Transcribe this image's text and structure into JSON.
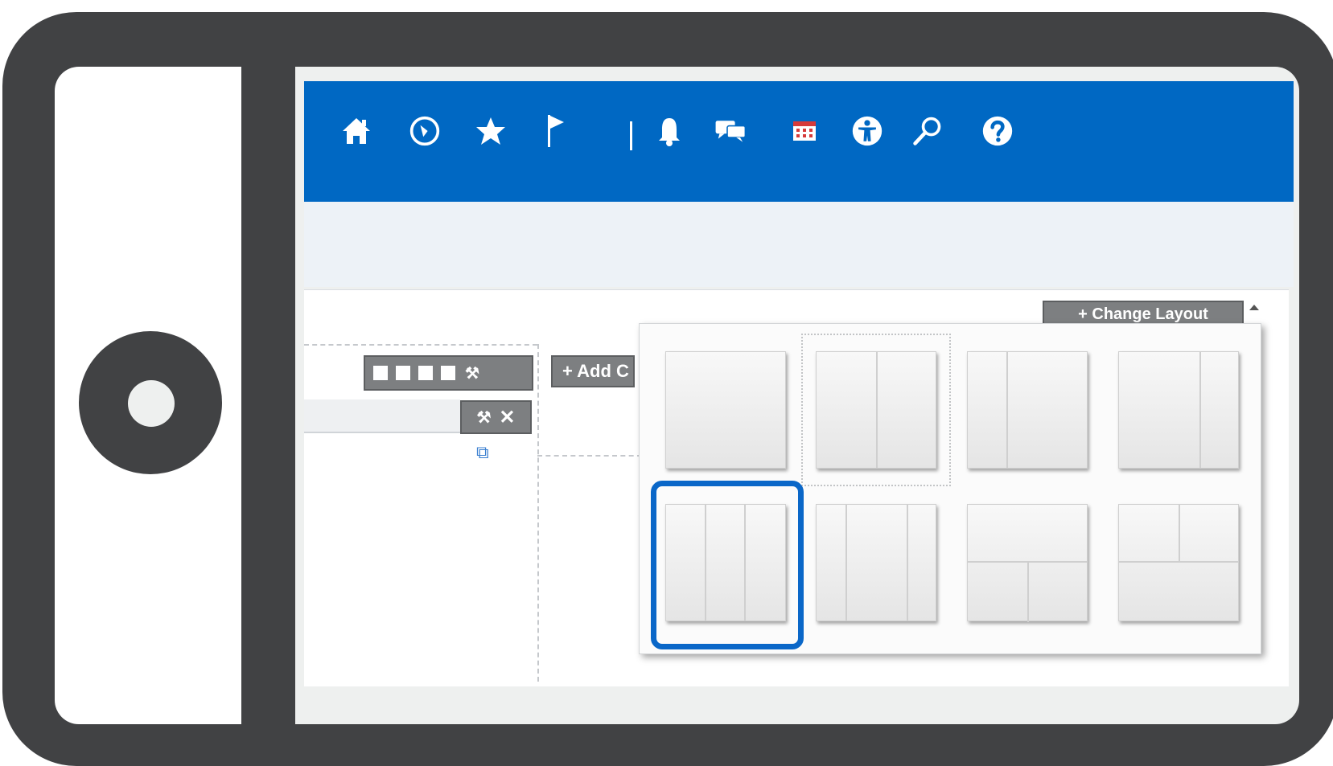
{
  "device": {
    "type": "tablet-frame-icon"
  },
  "topbar": {
    "icons": [
      "home-icon",
      "clock-icon",
      "star-icon",
      "flag-icon",
      "bell-icon",
      "chat-icon",
      "calendar-icon",
      "accessibility-icon",
      "search-icon",
      "help-icon"
    ],
    "color": "#0068c3"
  },
  "toolbar": {
    "add_label": "+ Add C",
    "change_layout_label": "+ Change Layout"
  },
  "layout_picker": {
    "options": [
      "one-column",
      "two-columns-equal",
      "two-columns-narrow-left",
      "two-columns-narrow-right",
      "three-columns-equal",
      "three-columns-wide-center",
      "header-two-columns",
      "two-columns-footer"
    ],
    "selected_option": "two-columns-equal",
    "highlighted_option": "three-columns-equal"
  }
}
